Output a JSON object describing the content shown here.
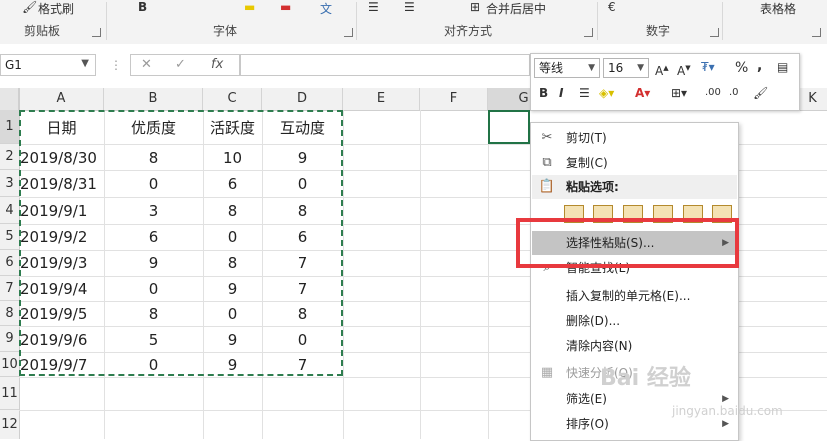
{
  "ribbon": {
    "format_painter": "格式刷",
    "groups": [
      "剪贴板",
      "字体",
      "对齐方式",
      "数字"
    ],
    "merge_center": "合并后居中",
    "table_format": "表格格"
  },
  "formula_bar": {
    "name_box": "G1",
    "fx": "fx"
  },
  "columns": [
    "A",
    "B",
    "C",
    "D",
    "E",
    "F",
    "G",
    "K"
  ],
  "rows": [
    "1",
    "2",
    "3",
    "4",
    "5",
    "6",
    "7",
    "8",
    "9",
    "10",
    "11",
    "12"
  ],
  "table": {
    "headers": [
      "日期",
      "优质度",
      "活跃度",
      "互动度"
    ],
    "rows": [
      [
        "2019/8/30",
        "8",
        "10",
        "9"
      ],
      [
        "2019/8/31",
        "0",
        "6",
        "0"
      ],
      [
        "2019/9/1",
        "3",
        "8",
        "8"
      ],
      [
        "2019/9/2",
        "6",
        "0",
        "6"
      ],
      [
        "2019/9/3",
        "9",
        "8",
        "7"
      ],
      [
        "2019/9/4",
        "0",
        "9",
        "7"
      ],
      [
        "2019/9/5",
        "8",
        "0",
        "8"
      ],
      [
        "2019/9/6",
        "5",
        "9",
        "0"
      ],
      [
        "2019/9/7",
        "0",
        "9",
        "7"
      ]
    ]
  },
  "mini_toolbar": {
    "font_name": "等线",
    "font_size": "16",
    "percent": "%",
    "comma": ","
  },
  "context_menu": {
    "cut": "剪切(T)",
    "copy": "复制(C)",
    "paste_options": "粘贴选项:",
    "paste_special": "选择性粘贴(S)...",
    "smart_lookup": "智能查找(L)",
    "insert_copied": "插入复制的单元格(E)...",
    "delete": "删除(D)...",
    "clear": "清除内容(N)",
    "quick_analysis": "快速分析(Q)",
    "filter": "筛选(E)",
    "sort": "排序(O)"
  },
  "watermark": {
    "brand": "Bai 经验",
    "url": "jingyan.baidu.com"
  },
  "colors": {
    "marquee": "#2e7d4f",
    "callout": "#e8393e",
    "highlight": "#c4c4c4",
    "excel_green": "#217346"
  }
}
